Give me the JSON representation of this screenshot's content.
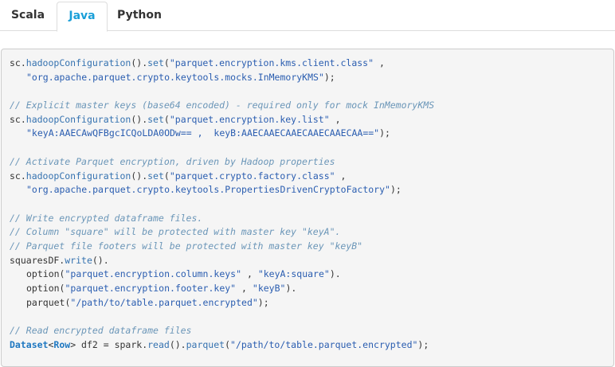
{
  "tabs": [
    {
      "label": "Scala",
      "active": false
    },
    {
      "label": "Java",
      "active": true
    },
    {
      "label": "Python",
      "active": false
    }
  ],
  "colors": {
    "active_tab": "#1a9fd8",
    "code_background": "#f5f5f5",
    "method": "#3572b0",
    "string": "#2a5db0",
    "comment": "#6b96b8"
  },
  "code": {
    "lines": [
      {
        "indent": false,
        "tokens": [
          {
            "t": "p",
            "v": "sc."
          },
          {
            "t": "m",
            "v": "hadoopConfiguration"
          },
          {
            "t": "p",
            "v": "()."
          },
          {
            "t": "m",
            "v": "set"
          },
          {
            "t": "p",
            "v": "("
          },
          {
            "t": "s",
            "v": "\"parquet.encryption.kms.client.class\""
          },
          {
            "t": "p",
            "v": " ,"
          }
        ]
      },
      {
        "indent": true,
        "tokens": [
          {
            "t": "s",
            "v": "\"org.apache.parquet.crypto.keytools.mocks.InMemoryKMS\""
          },
          {
            "t": "p",
            "v": ");"
          }
        ]
      },
      {
        "indent": false,
        "tokens": []
      },
      {
        "indent": false,
        "tokens": [
          {
            "t": "c",
            "v": "// Explicit master keys (base64 encoded) - required only for mock InMemoryKMS"
          }
        ]
      },
      {
        "indent": false,
        "tokens": [
          {
            "t": "p",
            "v": "sc."
          },
          {
            "t": "m",
            "v": "hadoopConfiguration"
          },
          {
            "t": "p",
            "v": "()."
          },
          {
            "t": "m",
            "v": "set"
          },
          {
            "t": "p",
            "v": "("
          },
          {
            "t": "s",
            "v": "\"parquet.encryption.key.list\""
          },
          {
            "t": "p",
            "v": " ,"
          }
        ]
      },
      {
        "indent": true,
        "tokens": [
          {
            "t": "s",
            "v": "\"keyA:AAECAwQFBgcICQoLDA0ODw== ,  keyB:AAECAAECAAECAAECAAECAA==\""
          },
          {
            "t": "p",
            "v": ");"
          }
        ]
      },
      {
        "indent": false,
        "tokens": []
      },
      {
        "indent": false,
        "tokens": [
          {
            "t": "c",
            "v": "// Activate Parquet encryption, driven by Hadoop properties"
          }
        ]
      },
      {
        "indent": false,
        "tokens": [
          {
            "t": "p",
            "v": "sc."
          },
          {
            "t": "m",
            "v": "hadoopConfiguration"
          },
          {
            "t": "p",
            "v": "()."
          },
          {
            "t": "m",
            "v": "set"
          },
          {
            "t": "p",
            "v": "("
          },
          {
            "t": "s",
            "v": "\"parquet.crypto.factory.class\""
          },
          {
            "t": "p",
            "v": " ,"
          }
        ]
      },
      {
        "indent": true,
        "tokens": [
          {
            "t": "s",
            "v": "\"org.apache.parquet.crypto.keytools.PropertiesDrivenCryptoFactory\""
          },
          {
            "t": "p",
            "v": ");"
          }
        ]
      },
      {
        "indent": false,
        "tokens": []
      },
      {
        "indent": false,
        "tokens": [
          {
            "t": "c",
            "v": "// Write encrypted dataframe files."
          }
        ]
      },
      {
        "indent": false,
        "tokens": [
          {
            "t": "c",
            "v": "// Column \"square\" will be protected with master key \"keyA\"."
          }
        ]
      },
      {
        "indent": false,
        "tokens": [
          {
            "t": "c",
            "v": "// Parquet file footers will be protected with master key \"keyB\""
          }
        ]
      },
      {
        "indent": false,
        "tokens": [
          {
            "t": "p",
            "v": "squaresDF."
          },
          {
            "t": "m",
            "v": "write"
          },
          {
            "t": "p",
            "v": "()."
          }
        ]
      },
      {
        "indent": true,
        "tokens": [
          {
            "t": "p",
            "v": "option("
          },
          {
            "t": "s",
            "v": "\"parquet.encryption.column.keys\""
          },
          {
            "t": "p",
            "v": " , "
          },
          {
            "t": "s",
            "v": "\"keyA:square\""
          },
          {
            "t": "p",
            "v": ")."
          }
        ]
      },
      {
        "indent": true,
        "tokens": [
          {
            "t": "p",
            "v": "option("
          },
          {
            "t": "s",
            "v": "\"parquet.encryption.footer.key\""
          },
          {
            "t": "p",
            "v": " , "
          },
          {
            "t": "s",
            "v": "\"keyB\""
          },
          {
            "t": "p",
            "v": ")."
          }
        ]
      },
      {
        "indent": true,
        "tokens": [
          {
            "t": "p",
            "v": "parquet("
          },
          {
            "t": "s",
            "v": "\"/path/to/table.parquet.encrypted\""
          },
          {
            "t": "p",
            "v": ");"
          }
        ]
      },
      {
        "indent": false,
        "tokens": []
      },
      {
        "indent": false,
        "tokens": [
          {
            "t": "c",
            "v": "// Read encrypted dataframe files"
          }
        ]
      },
      {
        "indent": false,
        "tokens": [
          {
            "t": "k",
            "v": "Dataset"
          },
          {
            "t": "p",
            "v": "<"
          },
          {
            "t": "k",
            "v": "Row"
          },
          {
            "t": "p",
            "v": "> df2 = spark."
          },
          {
            "t": "m",
            "v": "read"
          },
          {
            "t": "p",
            "v": "()."
          },
          {
            "t": "m",
            "v": "parquet"
          },
          {
            "t": "p",
            "v": "("
          },
          {
            "t": "s",
            "v": "\"/path/to/table.parquet.encrypted\""
          },
          {
            "t": "p",
            "v": ");"
          }
        ]
      }
    ]
  }
}
